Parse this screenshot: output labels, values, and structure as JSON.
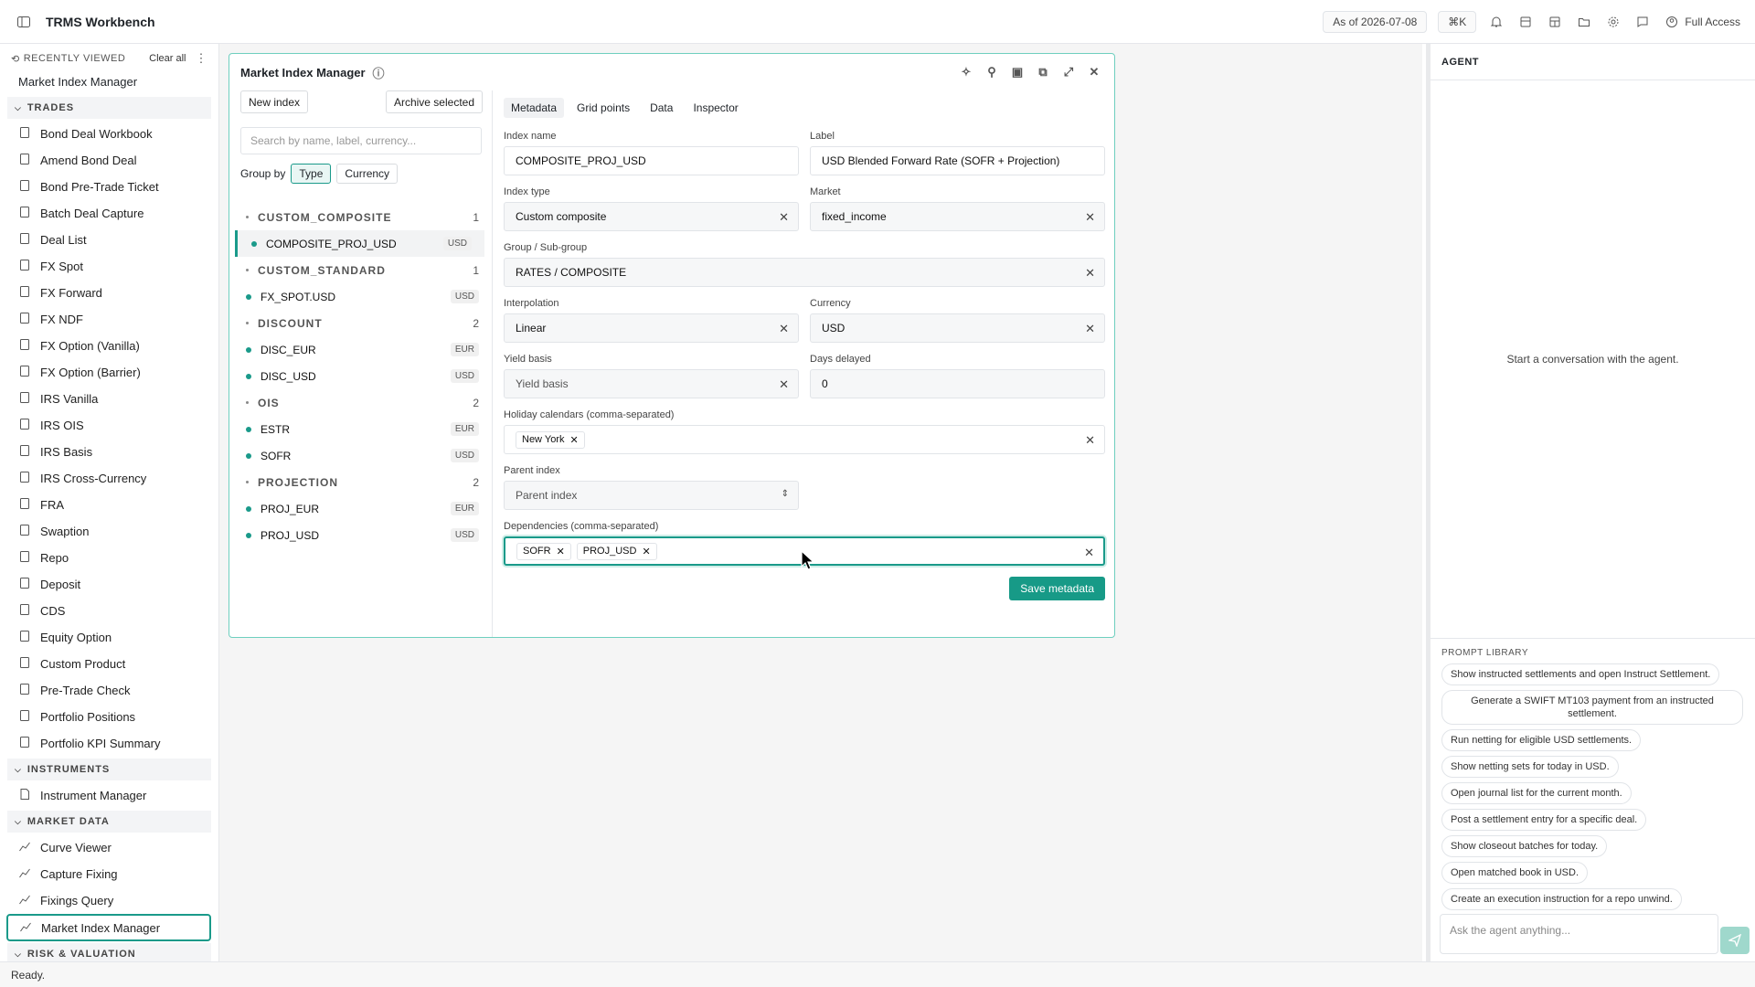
{
  "app": {
    "title": "TRMS Workbench",
    "as_of": "As of 2026-07-08",
    "shortcut": "⌘K",
    "access": "Full Access",
    "status": "Ready."
  },
  "sidebar": {
    "recent_title": "RECENTLY VIEWED",
    "clear_all": "Clear all",
    "recent": [
      "Market Index Manager"
    ],
    "sections": [
      {
        "title": "TRADES",
        "items": [
          "Bond Deal Workbook",
          "Amend Bond Deal",
          "Bond Pre-Trade Ticket",
          "Batch Deal Capture",
          "Deal List",
          "FX Spot",
          "FX Forward",
          "FX NDF",
          "FX Option (Vanilla)",
          "FX Option (Barrier)",
          "IRS Vanilla",
          "IRS OIS",
          "IRS Basis",
          "IRS Cross-Currency",
          "FRA",
          "Swaption",
          "Repo",
          "Deposit",
          "CDS",
          "Equity Option",
          "Custom Product",
          "Pre-Trade Check",
          "Portfolio Positions",
          "Portfolio KPI Summary"
        ]
      },
      {
        "title": "INSTRUMENTS",
        "items": [
          "Instrument Manager"
        ]
      },
      {
        "title": "MARKET DATA",
        "items": [
          "Curve Viewer",
          "Capture Fixing",
          "Fixings Query",
          "Market Index Manager"
        ]
      },
      {
        "title": "RISK & VALUATION",
        "items": []
      }
    ]
  },
  "panel": {
    "title": "Market Index Manager",
    "new_index": "New index",
    "archive": "Archive selected",
    "search_placeholder": "Search by name, label, currency...",
    "group_by": "Group by",
    "group_opts": [
      "Type",
      "Currency"
    ],
    "groups": [
      {
        "name": "CUSTOM_COMPOSITE",
        "count": "1",
        "items": [
          {
            "name": "COMPOSITE_PROJ_USD",
            "ccy": "USD"
          }
        ]
      },
      {
        "name": "CUSTOM_STANDARD",
        "count": "1",
        "items": [
          {
            "name": "FX_SPOT.USD",
            "ccy": "USD"
          }
        ]
      },
      {
        "name": "DISCOUNT",
        "count": "2",
        "items": [
          {
            "name": "DISC_EUR",
            "ccy": "EUR"
          },
          {
            "name": "DISC_USD",
            "ccy": "USD"
          }
        ]
      },
      {
        "name": "OIS",
        "count": "2",
        "items": [
          {
            "name": "ESTR",
            "ccy": "EUR"
          },
          {
            "name": "SOFR",
            "ccy": "USD"
          }
        ]
      },
      {
        "name": "PROJECTION",
        "count": "2",
        "items": [
          {
            "name": "PROJ_EUR",
            "ccy": "EUR"
          },
          {
            "name": "PROJ_USD",
            "ccy": "USD"
          }
        ]
      }
    ],
    "tabs": [
      "Metadata",
      "Grid points",
      "Data",
      "Inspector"
    ],
    "form": {
      "index_name_label": "Index name",
      "index_name": "COMPOSITE_PROJ_USD",
      "label_label": "Label",
      "label": "USD Blended Forward Rate (SOFR + Projection)",
      "type_label": "Index type",
      "type": "Custom composite",
      "market_label": "Market",
      "market": "fixed_income",
      "group_label": "Group / Sub-group",
      "group": "RATES / COMPOSITE",
      "interp_label": "Interpolation",
      "interp": "Linear",
      "currency_label": "Currency",
      "currency": "USD",
      "yield_label": "Yield basis",
      "yield_placeholder": "Yield basis",
      "days_label": "Days delayed",
      "days": "0",
      "holiday_label": "Holiday calendars (comma-separated)",
      "holidays": [
        "New York"
      ],
      "parent_label": "Parent index",
      "parent_placeholder": "Parent index",
      "deps_label": "Dependencies (comma-separated)",
      "deps": [
        "SOFR",
        "PROJ_USD"
      ],
      "save": "Save metadata"
    }
  },
  "agent": {
    "title": "AGENT",
    "empty": "Start a conversation with the agent.",
    "library_title": "PROMPT LIBRARY",
    "prompts": [
      "Show instructed settlements and open Instruct Settlement.",
      "Generate a SWIFT MT103 payment from an instructed settlement.",
      "Run netting for eligible USD settlements.",
      "Show netting sets for today in USD.",
      "Open journal list for the current month.",
      "Post a settlement entry for a specific deal.",
      "Show closeout batches for today.",
      "Open matched book in USD.",
      "Create an execution instruction for a repo unwind."
    ],
    "input_placeholder": "Ask the agent anything..."
  }
}
